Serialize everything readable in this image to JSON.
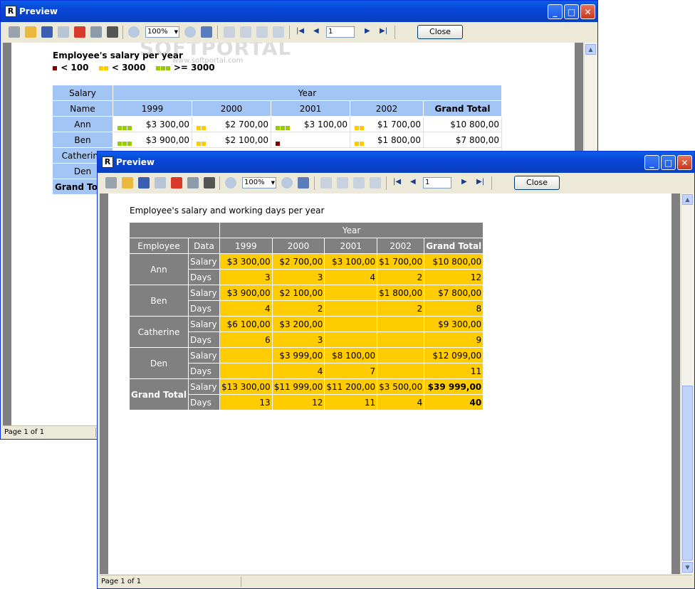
{
  "back_window": {
    "title": "Preview",
    "zoom": "100%",
    "page_input": "1",
    "close_label": "Close",
    "status": "Page 1 of 1",
    "report_title": "Employee's salary per year",
    "legend": [
      {
        "label": "< 100",
        "color": "#800000"
      },
      {
        "label": "< 3000",
        "color": "#ffcc00"
      },
      {
        "label": ">= 3000",
        "color": "#99cc00"
      }
    ],
    "watermark_main": "SOFTPORTAL",
    "watermark_url": "www.softportal.com",
    "header_row1": {
      "salary": "Salary",
      "year": "Year"
    },
    "header_row2": {
      "name": "Name",
      "years": [
        "1999",
        "2000",
        "2001",
        "2002"
      ],
      "grand_total": "Grand Total"
    },
    "rows": [
      {
        "name": "Ann",
        "cells": [
          "$3 300,00",
          "$2 700,00",
          "$3 100,00",
          "$1 700,00"
        ],
        "total": "$10 800,00"
      },
      {
        "name": "Ben",
        "cells": [
          "$3 900,00",
          "$2 100,00",
          "",
          "$1 800,00"
        ],
        "total": "$7 800,00"
      }
    ],
    "hidden_rows": [
      "Catherine",
      "Den",
      "Grand Total"
    ]
  },
  "front_window": {
    "title": "Preview",
    "zoom": "100%",
    "page_input": "1",
    "close_label": "Close",
    "status": "Page 1 of 1",
    "report_title": "Employee's salary and working days per year",
    "header": {
      "year": "Year",
      "employee": "Employee",
      "data": "Data",
      "years": [
        "1999",
        "2000",
        "2001",
        "2002"
      ],
      "grand_total": "Grand Total"
    },
    "rows": [
      {
        "employee": "Ann",
        "salary": [
          "$3 300,00",
          "$2 700,00",
          "$3 100,00",
          "$1 700,00",
          "$10 800,00"
        ],
        "days": [
          "3",
          "3",
          "4",
          "2",
          "12"
        ]
      },
      {
        "employee": "Ben",
        "salary": [
          "$3 900,00",
          "$2 100,00",
          "",
          "$1 800,00",
          "$7 800,00"
        ],
        "days": [
          "4",
          "2",
          "",
          "2",
          "8"
        ]
      },
      {
        "employee": "Catherine",
        "salary": [
          "$6 100,00",
          "$3 200,00",
          "",
          "",
          "$9 300,00"
        ],
        "days": [
          "6",
          "3",
          "",
          "",
          "9"
        ]
      },
      {
        "employee": "Den",
        "salary": [
          "",
          "$3 999,00",
          "$8 100,00",
          "",
          "$12 099,00"
        ],
        "days": [
          "",
          "4",
          "7",
          "",
          "11"
        ]
      },
      {
        "employee": "Grand Total",
        "salary": [
          "$13 300,00",
          "$11 999,00",
          "$11 200,00",
          "$3 500,00",
          "$39 999,00"
        ],
        "days": [
          "13",
          "12",
          "11",
          "4",
          "40"
        ]
      }
    ],
    "data_labels": {
      "salary": "Salary",
      "days": "Days"
    }
  },
  "toolbar_icons": [
    "print-icon",
    "open-icon",
    "save-icon",
    "export-icon",
    "pdf-icon",
    "copy-icon",
    "find-icon",
    "zoom-in-icon",
    "zoom-out-icon",
    "full-screen-icon",
    "page-setup-icon",
    "outline-icon",
    "thumbnails-icon",
    "edit-icon",
    "first-page-icon",
    "prev-page-icon",
    "next-page-icon",
    "last-page-icon"
  ]
}
